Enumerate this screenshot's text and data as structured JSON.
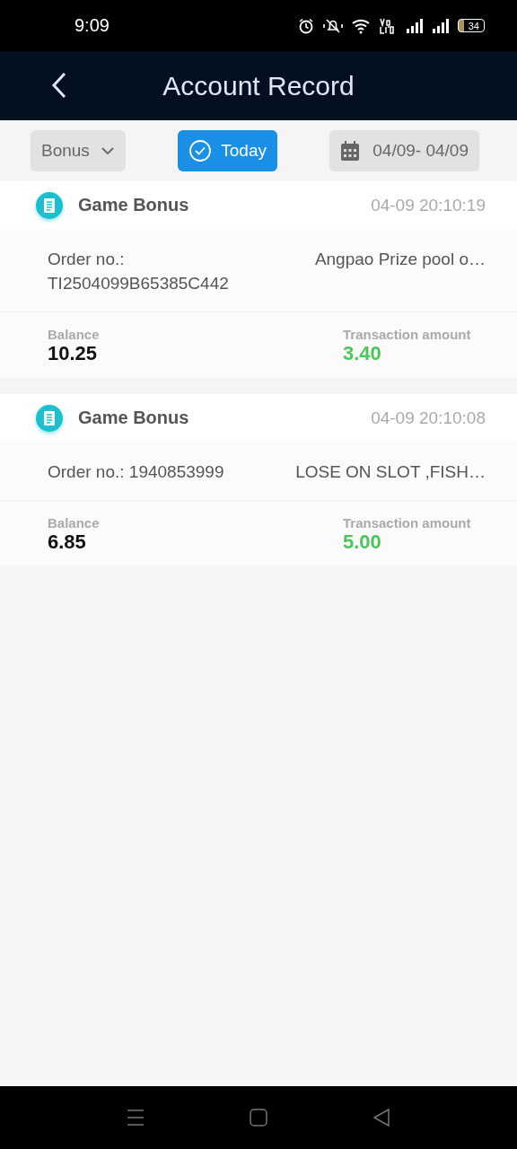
{
  "status_bar": {
    "time": "9:09",
    "battery": "34"
  },
  "header": {
    "title": "Account Record"
  },
  "filters": {
    "type": "Bonus",
    "today": {
      "label": "Today",
      "selected": true
    },
    "date_range": "04/09- 04/09"
  },
  "records": [
    {
      "title": "Game Bonus",
      "time": "04-09 20:10:19",
      "order": "Order no.: TI2504099B65385C442",
      "description": "Angpao Prize pool o…",
      "balance_label": "Balance",
      "balance": "10.25",
      "amount_label": "Transaction amount",
      "amount": "3.40"
    },
    {
      "title": "Game Bonus",
      "time": "04-09 20:10:08",
      "order": "Order no.: 1940853999",
      "description": "LOSE ON SLOT ,FISH…",
      "balance_label": "Balance",
      "balance": "6.85",
      "amount_label": "Transaction amount",
      "amount": "5.00"
    }
  ]
}
